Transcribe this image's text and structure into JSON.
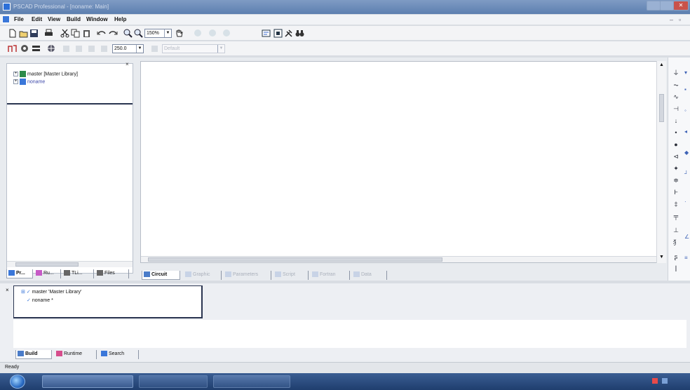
{
  "window": {
    "title": "PSCAD Professional - [noname: Main]"
  },
  "menu": {
    "items": [
      "File",
      "Edit",
      "View",
      "Build",
      "Window",
      "Help"
    ]
  },
  "toolbar": {
    "zoom_value": "150%",
    "time_value": "250.0",
    "disabled_combo_value": "Default"
  },
  "workspace_tree": {
    "items": [
      {
        "label": "master [Master Library]"
      },
      {
        "label": "noname"
      }
    ]
  },
  "workspace_tabs": [
    {
      "label": "Pr..."
    },
    {
      "label": "Ru..."
    },
    {
      "label": "TLi..."
    },
    {
      "label": "Files"
    }
  ],
  "canvas_tabs": [
    {
      "label": "Circuit",
      "active": true
    },
    {
      "label": "Graphic",
      "active": false
    },
    {
      "label": "Parameters",
      "active": false
    },
    {
      "label": "Script",
      "active": false
    },
    {
      "label": "Fortran",
      "active": false
    },
    {
      "label": "Data",
      "active": false
    }
  ],
  "output": {
    "lines": [
      "master 'Master Library'",
      "noname *"
    ]
  },
  "bottom_tabs": [
    {
      "label": "Build"
    },
    {
      "label": "Runtime"
    },
    {
      "label": "Search"
    }
  ],
  "status": {
    "text": "Ready"
  },
  "palette_icons": [
    "ground-icon",
    "resistor-icon",
    "inductor-icon",
    "capacitor-icon",
    "source-icon",
    "node-icon",
    "breaker-icon",
    "diode-icon",
    "thyristor-icon",
    "transformer-icon",
    "meter-icon",
    "plot-icon"
  ],
  "colors": {
    "title_bar": "#5c7fb0",
    "taskbar": "#1f3e6e",
    "accent_blue": "#2b6fd8"
  }
}
